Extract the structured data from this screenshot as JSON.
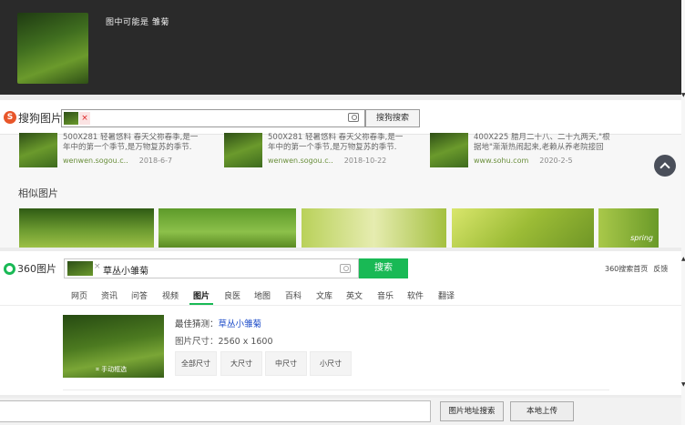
{
  "top_panel": {
    "label": "图中可能是  雏菊"
  },
  "sogou": {
    "logo_text": "搜狗图片",
    "logo_letter": "S",
    "remove_icon": "×",
    "search_button": "搜狗搜索",
    "results": [
      {
        "text1": "500X281 轻暑悠料 春天父祢春季,是一",
        "text2": "年中的第一个季节,是万物复苏的季节.",
        "source": "wenwen.sogou.c..",
        "date": "2018-6-7"
      },
      {
        "text1": "500X281 轻暑悠料 春天父祢春季,是一",
        "text2": "年中的第一个季节,是万物复苏的季节.",
        "source": "wenwen.sogou.c..",
        "date": "2018-10-22"
      },
      {
        "text1": "400X225 腊月二十八、二十九两天,\"根",
        "text2": "据地\"渐渐热闹起来,老赖从养老院接回",
        "source": "www.sohu.com",
        "date": "2020-2-5"
      }
    ],
    "similar_title": "相似图片",
    "similar_overlay": "spring"
  },
  "s360": {
    "logo_text": "360图片",
    "query": "草丛小雏菊",
    "remove_icon": "×",
    "search_button": "搜索",
    "links": [
      "360搜索首页",
      "反馈"
    ],
    "tabs": [
      "网页",
      "资讯",
      "问答",
      "视频",
      "图片",
      "良医",
      "地图",
      "百科",
      "文库",
      "英文",
      "音乐",
      "软件",
      "翻译"
    ],
    "active_tab": "图片",
    "crop_label": "手动框选",
    "best_guess_label": "最佳猜测：",
    "best_guess_value": "草丛小雏菊",
    "size_label": "图片尺寸：2560 x 1600",
    "size_buttons": [
      "全部尺寸",
      "大尺寸",
      "中尺寸",
      "小尺寸"
    ]
  },
  "bottom": {
    "url_search_button": "图片地址搜索",
    "upload_button": "本地上传"
  }
}
